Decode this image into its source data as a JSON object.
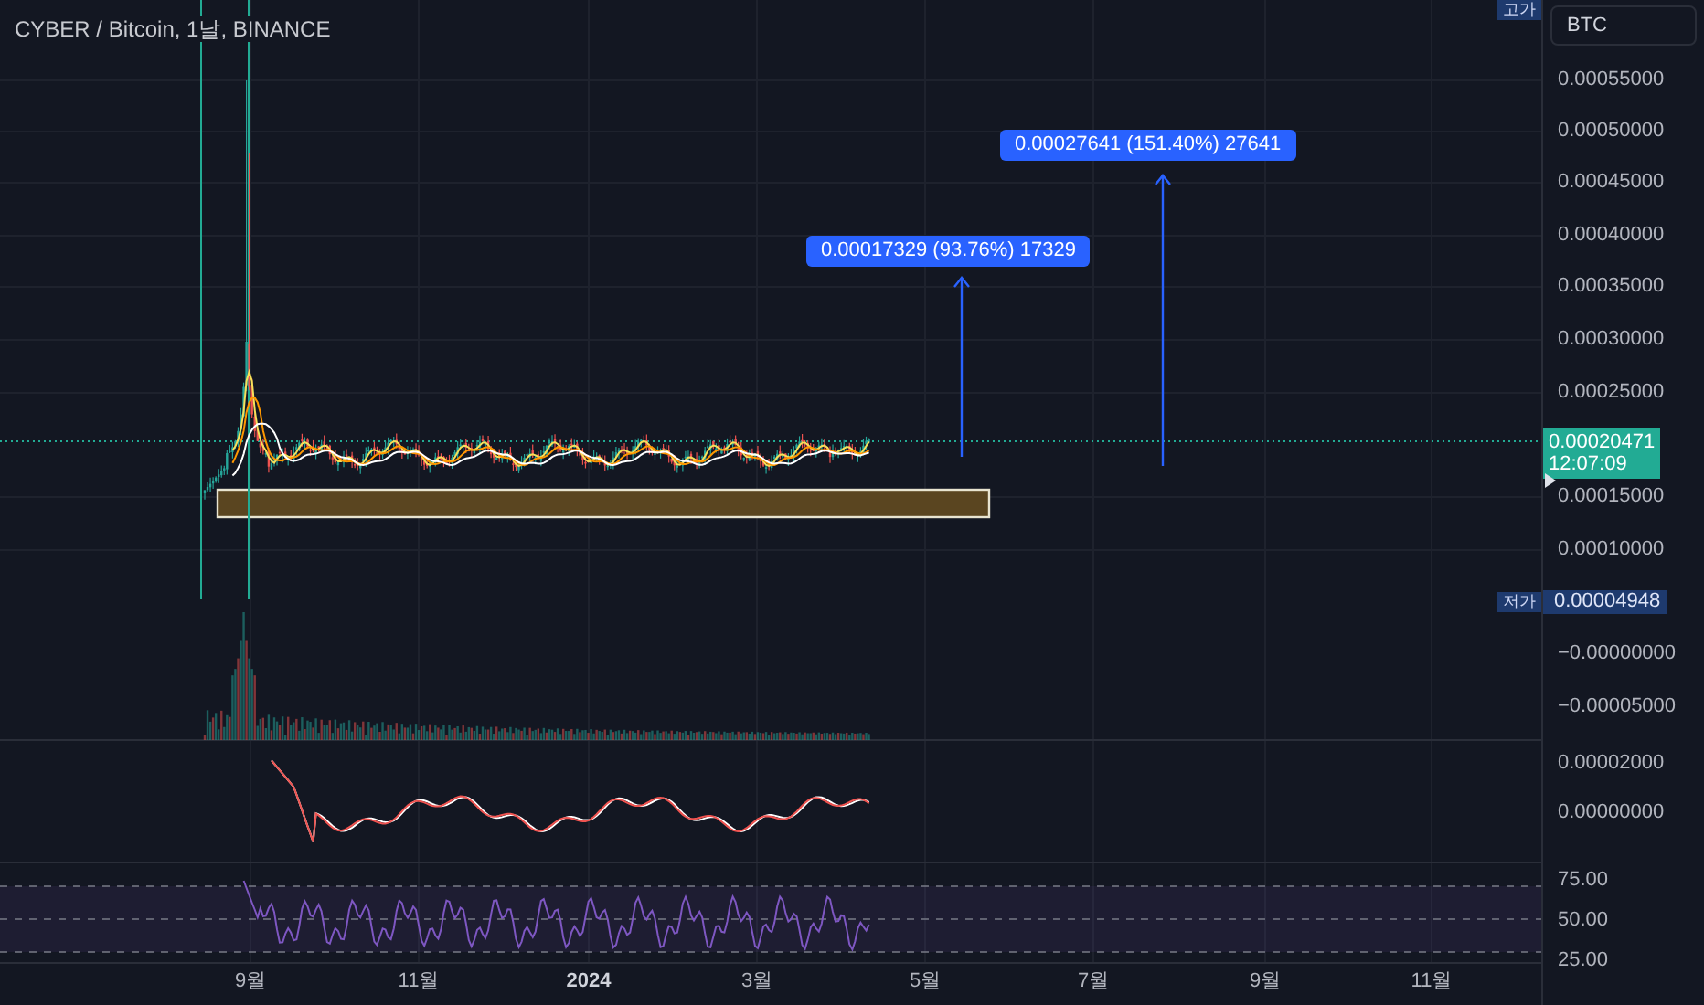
{
  "header": {
    "title": "CYBER / Bitcoin, 1날, BINANCE"
  },
  "price_axis": {
    "currency": "BTC",
    "high_tag": "고가",
    "ticks": [
      "0.00055000",
      "0.00050000",
      "0.00045000",
      "0.00040000",
      "0.00035000",
      "0.00030000",
      "0.00025000",
      "0.00015000",
      "0.00010000"
    ],
    "current_price": "0.00020471",
    "countdown": "12:07:09",
    "low_tag": "저가",
    "low_price": "0.00004948"
  },
  "volume_axis": {
    "ticks": [
      "−0.00000000",
      "−0.00005000"
    ]
  },
  "macd_axis": {
    "ticks": [
      "0.00002000",
      "0.00000000"
    ]
  },
  "rsi_axis": {
    "ticks": [
      "75.00",
      "50.00",
      "25.00"
    ]
  },
  "time_axis": [
    {
      "label": "9월",
      "emphasized": false
    },
    {
      "label": "11월",
      "emphasized": false
    },
    {
      "label": "2024",
      "emphasized": true
    },
    {
      "label": "3월",
      "emphasized": false
    },
    {
      "label": "5월",
      "emphasized": false
    },
    {
      "label": "7월",
      "emphasized": false
    },
    {
      "label": "9월",
      "emphasized": false
    },
    {
      "label": "11월",
      "emphasized": false
    }
  ],
  "measurements": [
    {
      "label": "0.00017329 (93.76%) 17329"
    },
    {
      "label": "0.00027641 (151.40%) 27641"
    }
  ]
}
